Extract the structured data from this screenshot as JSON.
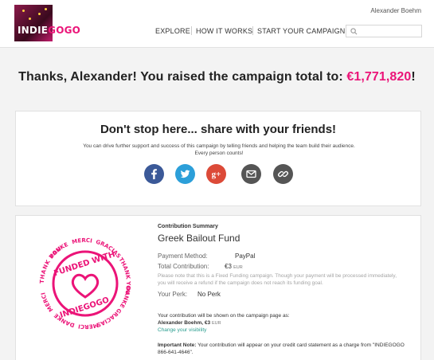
{
  "header": {
    "logo": {
      "text_white": "INDIE",
      "text_pink": "GOGO"
    },
    "user_name": "Alexander Boehm",
    "nav": [
      "EXPLORE",
      "HOW IT WORKS",
      "START YOUR CAMPAIGN"
    ],
    "search": {
      "placeholder": "",
      "icon": "search-icon"
    }
  },
  "thanks": {
    "prefix": "Thanks, Alexander! You raised the campaign total to: ",
    "amount": "€1,771,820",
    "suffix": "!"
  },
  "share": {
    "title": "Don't stop here... share with your friends!",
    "description_1": "You can drive further support and success of this campaign by telling friends and helping the team build their audience.",
    "description_2": "Every person counts!",
    "buttons": [
      {
        "icon": "facebook-icon",
        "color": "#3b5998"
      },
      {
        "icon": "twitter-icon",
        "color": "#2c9fd9"
      },
      {
        "icon": "google-plus-icon",
        "color": "#dc4a38"
      },
      {
        "icon": "email-icon",
        "color": "#555555"
      },
      {
        "icon": "link-icon",
        "color": "#555555"
      }
    ]
  },
  "badge": {
    "center_top": "FUNDED WITH",
    "center_bottom": "INDIEGOGO",
    "ring": [
      "THANK YOU",
      "DANKE",
      "MERCI",
      "GRACIAS",
      "THANK YOU",
      "DANKE",
      "GRACIAS",
      "MERCI",
      "DANKE",
      "MERCI"
    ]
  },
  "summary": {
    "label": "Contribution Summary",
    "fund_name": "Greek Bailout Fund",
    "payment_method_label": "Payment Method:",
    "payment_method": "PayPal",
    "total_label": "Total Contribution:",
    "total": "€3",
    "currency": "EUR",
    "note": "Please note that this is a Fixed Funding campaign. Though your payment will be processed immediately, you will receive a refund if the campaign does not reach its funding goal.",
    "perk_label": "Your Perk:",
    "perk": "No Perk",
    "shown_as": "Your contribution will be shown on the campaign page as:",
    "shown_name": "Alexander Boehm",
    "shown_amount": "€3",
    "shown_currency": "EUR",
    "change_visibility": "Change your visibility",
    "important_label": "Important Note:",
    "important_text": "Your contribution will appear on your credit card statement as a charge from \"INDIEGOGO 866-641-4646\"."
  },
  "colors": {
    "brand_pink": "#eb1478",
    "teal_link": "#2a9d8f"
  }
}
